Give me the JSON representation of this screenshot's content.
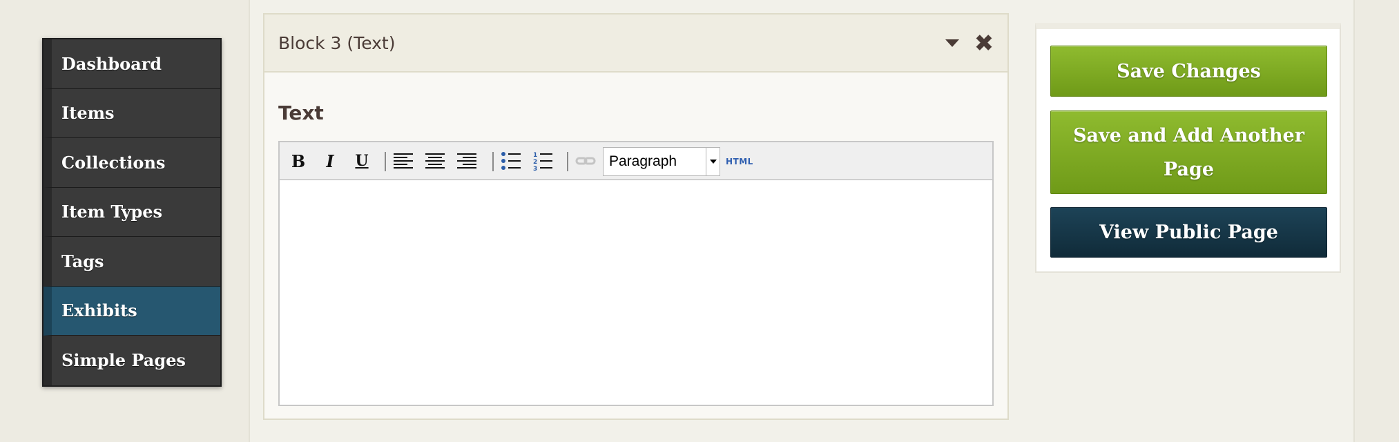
{
  "nav": {
    "items": [
      {
        "label": "Dashboard"
      },
      {
        "label": "Items"
      },
      {
        "label": "Collections"
      },
      {
        "label": "Item Types"
      },
      {
        "label": "Tags"
      },
      {
        "label": "Exhibits",
        "active": true
      },
      {
        "label": "Simple Pages"
      }
    ]
  },
  "block": {
    "title": "Block 3 (Text)",
    "field_label": "Text",
    "editor": {
      "format_value": "Paragraph",
      "html_label": "HTML",
      "content": ""
    }
  },
  "actions": {
    "save_changes": "Save Changes",
    "save_add_another": "Save and Add Another Page",
    "view_public": "View Public Page"
  },
  "colors": {
    "nav_active": "#265770",
    "button_green": "#7aa521",
    "button_navy": "#163848"
  }
}
